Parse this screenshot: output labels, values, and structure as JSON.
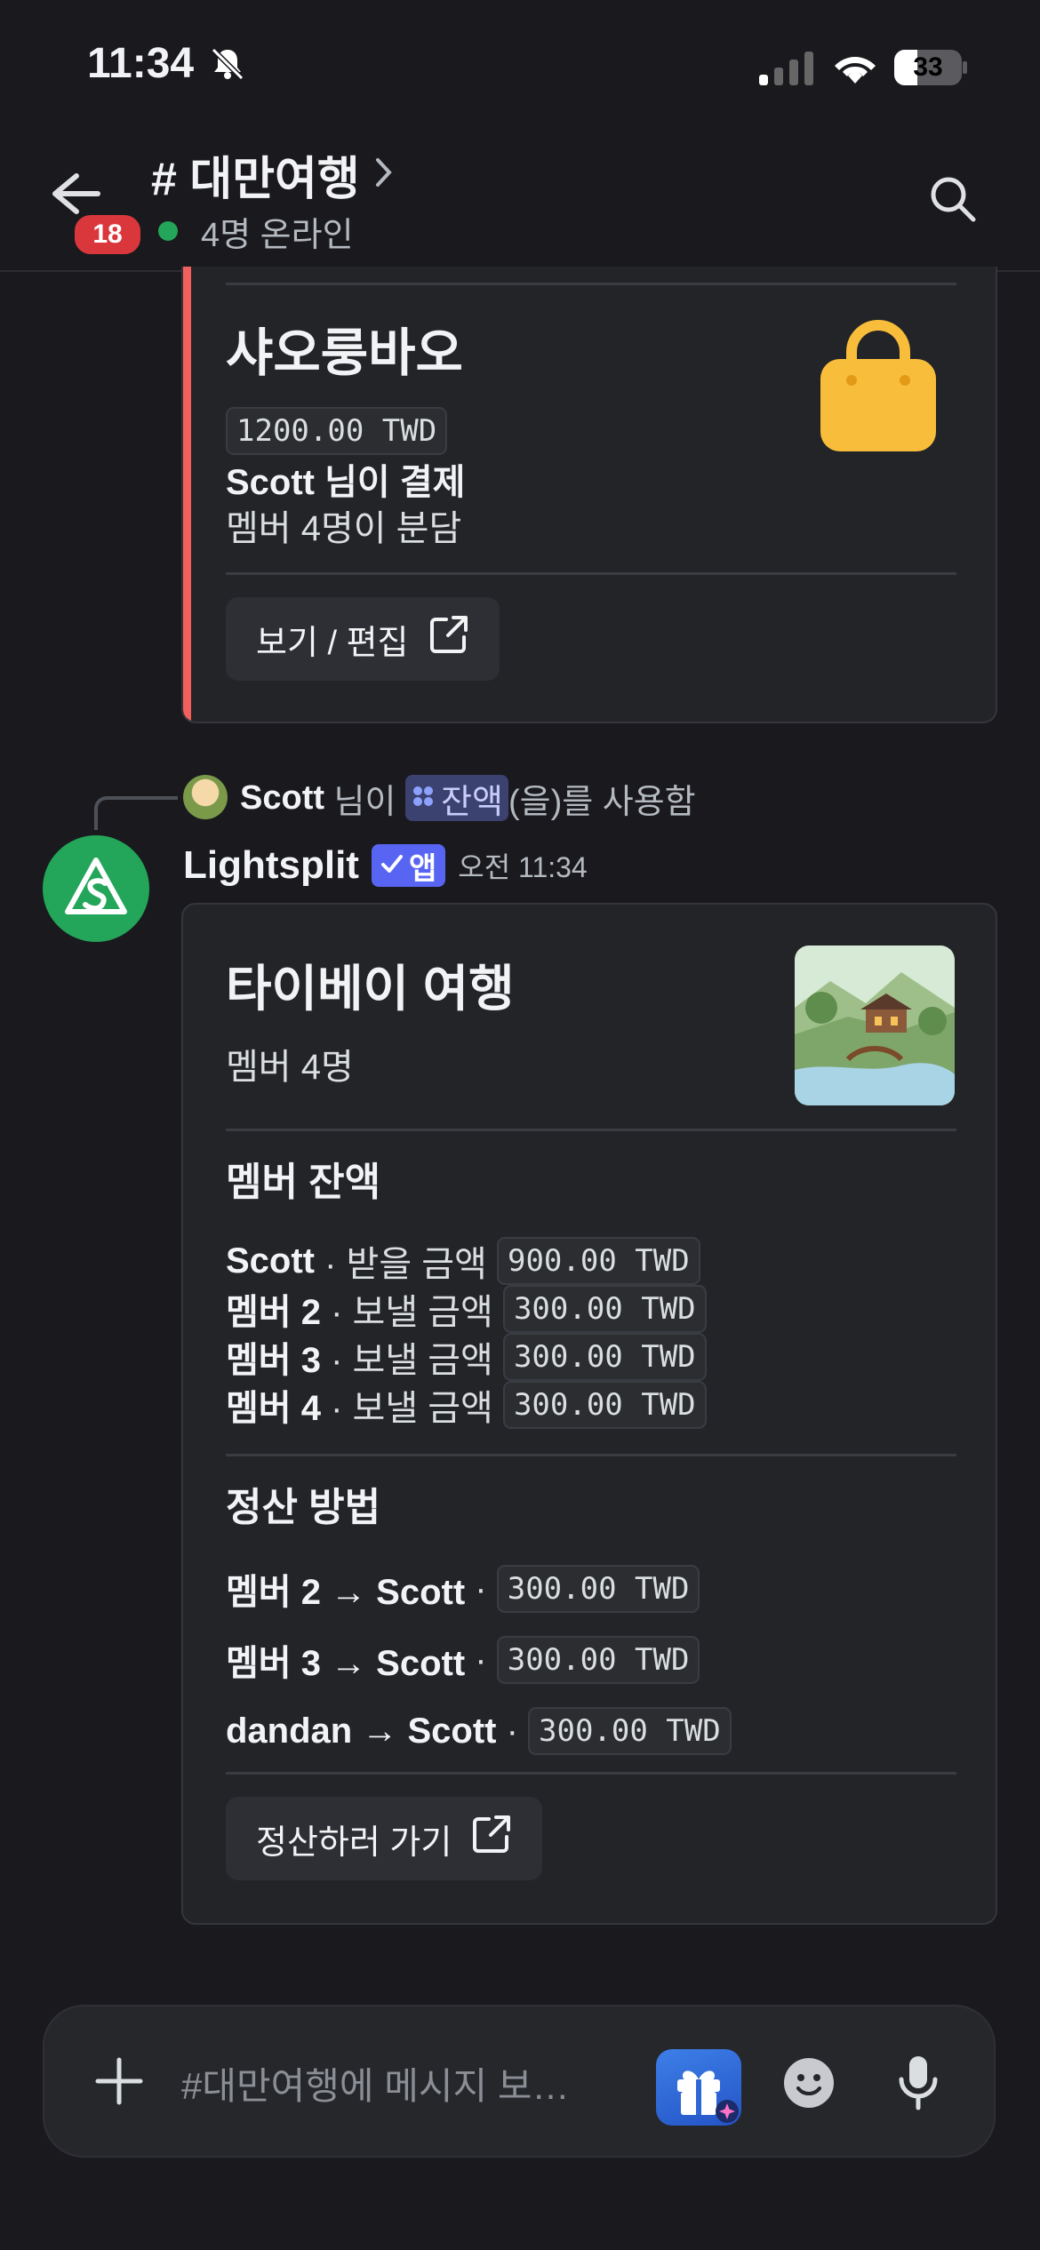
{
  "status_bar": {
    "time": "11:34",
    "battery": "33"
  },
  "header": {
    "channel": "# 대만여행",
    "online": "4명 온라인",
    "unread_badge": "18"
  },
  "expense_card": {
    "title": "샤오룽바오",
    "amount": "1200.00 TWD",
    "payer": "Scott 님이 결제",
    "split": "멤버 4명이 분담",
    "button": "보기 / 편집",
    "accent": "#f25f5c"
  },
  "reply_line": {
    "user": "Scott",
    "suffix": " 님이 ",
    "command": "잔액",
    "after": "(을)를 사용함"
  },
  "message": {
    "author": "Lightsplit",
    "app_badge": "앱",
    "timestamp": "오전 11:34",
    "brand_color": "#23a55a"
  },
  "trip_card": {
    "title": "타이베이 여행",
    "members": "멤버 4명",
    "balances_heading": "멤버 잔액",
    "balances": [
      {
        "name": "Scott",
        "label": " · 받을 금액 ",
        "amount": "900.00 TWD"
      },
      {
        "name": "멤버 2",
        "label": " · 보낼 금액 ",
        "amount": "300.00 TWD"
      },
      {
        "name": "멤버 3",
        "label": " · 보낼 금액 ",
        "amount": "300.00 TWD"
      },
      {
        "name": "멤버 4",
        "label": " · 보낼 금액 ",
        "amount": "300.00 TWD"
      }
    ],
    "settle_heading": "정산 방법",
    "settlements": [
      {
        "route": "멤버 2 → Scott",
        "sep": " · ",
        "amount": "300.00 TWD"
      },
      {
        "route": "멤버 3 → Scott",
        "sep": " · ",
        "amount": "300.00 TWD"
      },
      {
        "route": "dandan → Scott",
        "sep": " · ",
        "amount": "300.00 TWD"
      }
    ],
    "button": "정산하러 가기"
  },
  "composer": {
    "placeholder": "#대만여행에 메시지 보…"
  }
}
